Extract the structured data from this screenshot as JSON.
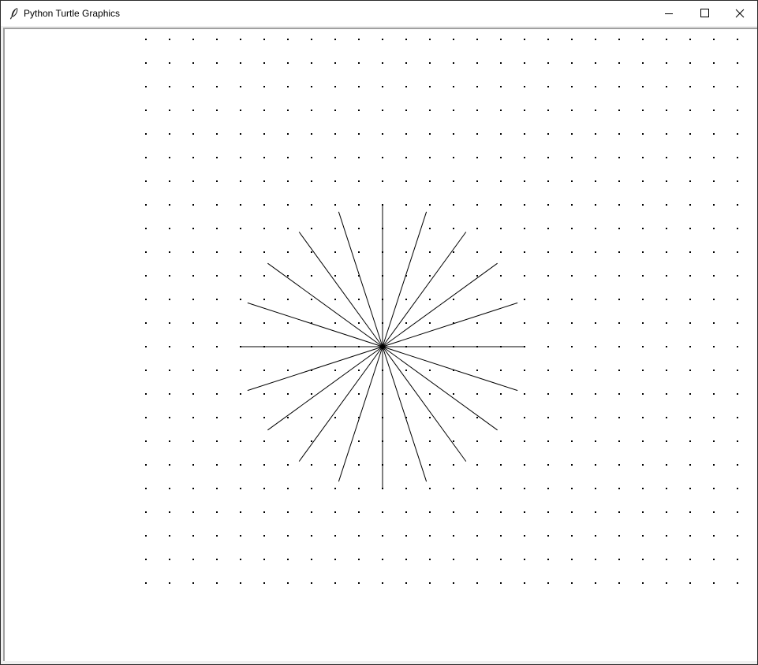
{
  "window": {
    "title": "Python Turtle Graphics",
    "app_icon": "feather-icon",
    "controls": {
      "minimize_icon": "minimize-icon",
      "maximize_icon": "maximize-icon",
      "close_icon": "close-icon"
    }
  },
  "canvas": {
    "background": "#ffffff",
    "ink_color": "#000000",
    "dot_grid": {
      "columns": 26,
      "rows": 24,
      "spacing": 30
    },
    "starburst": {
      "ray_count": 20,
      "angle_step_degrees": 18,
      "ray_length": 180
    }
  }
}
